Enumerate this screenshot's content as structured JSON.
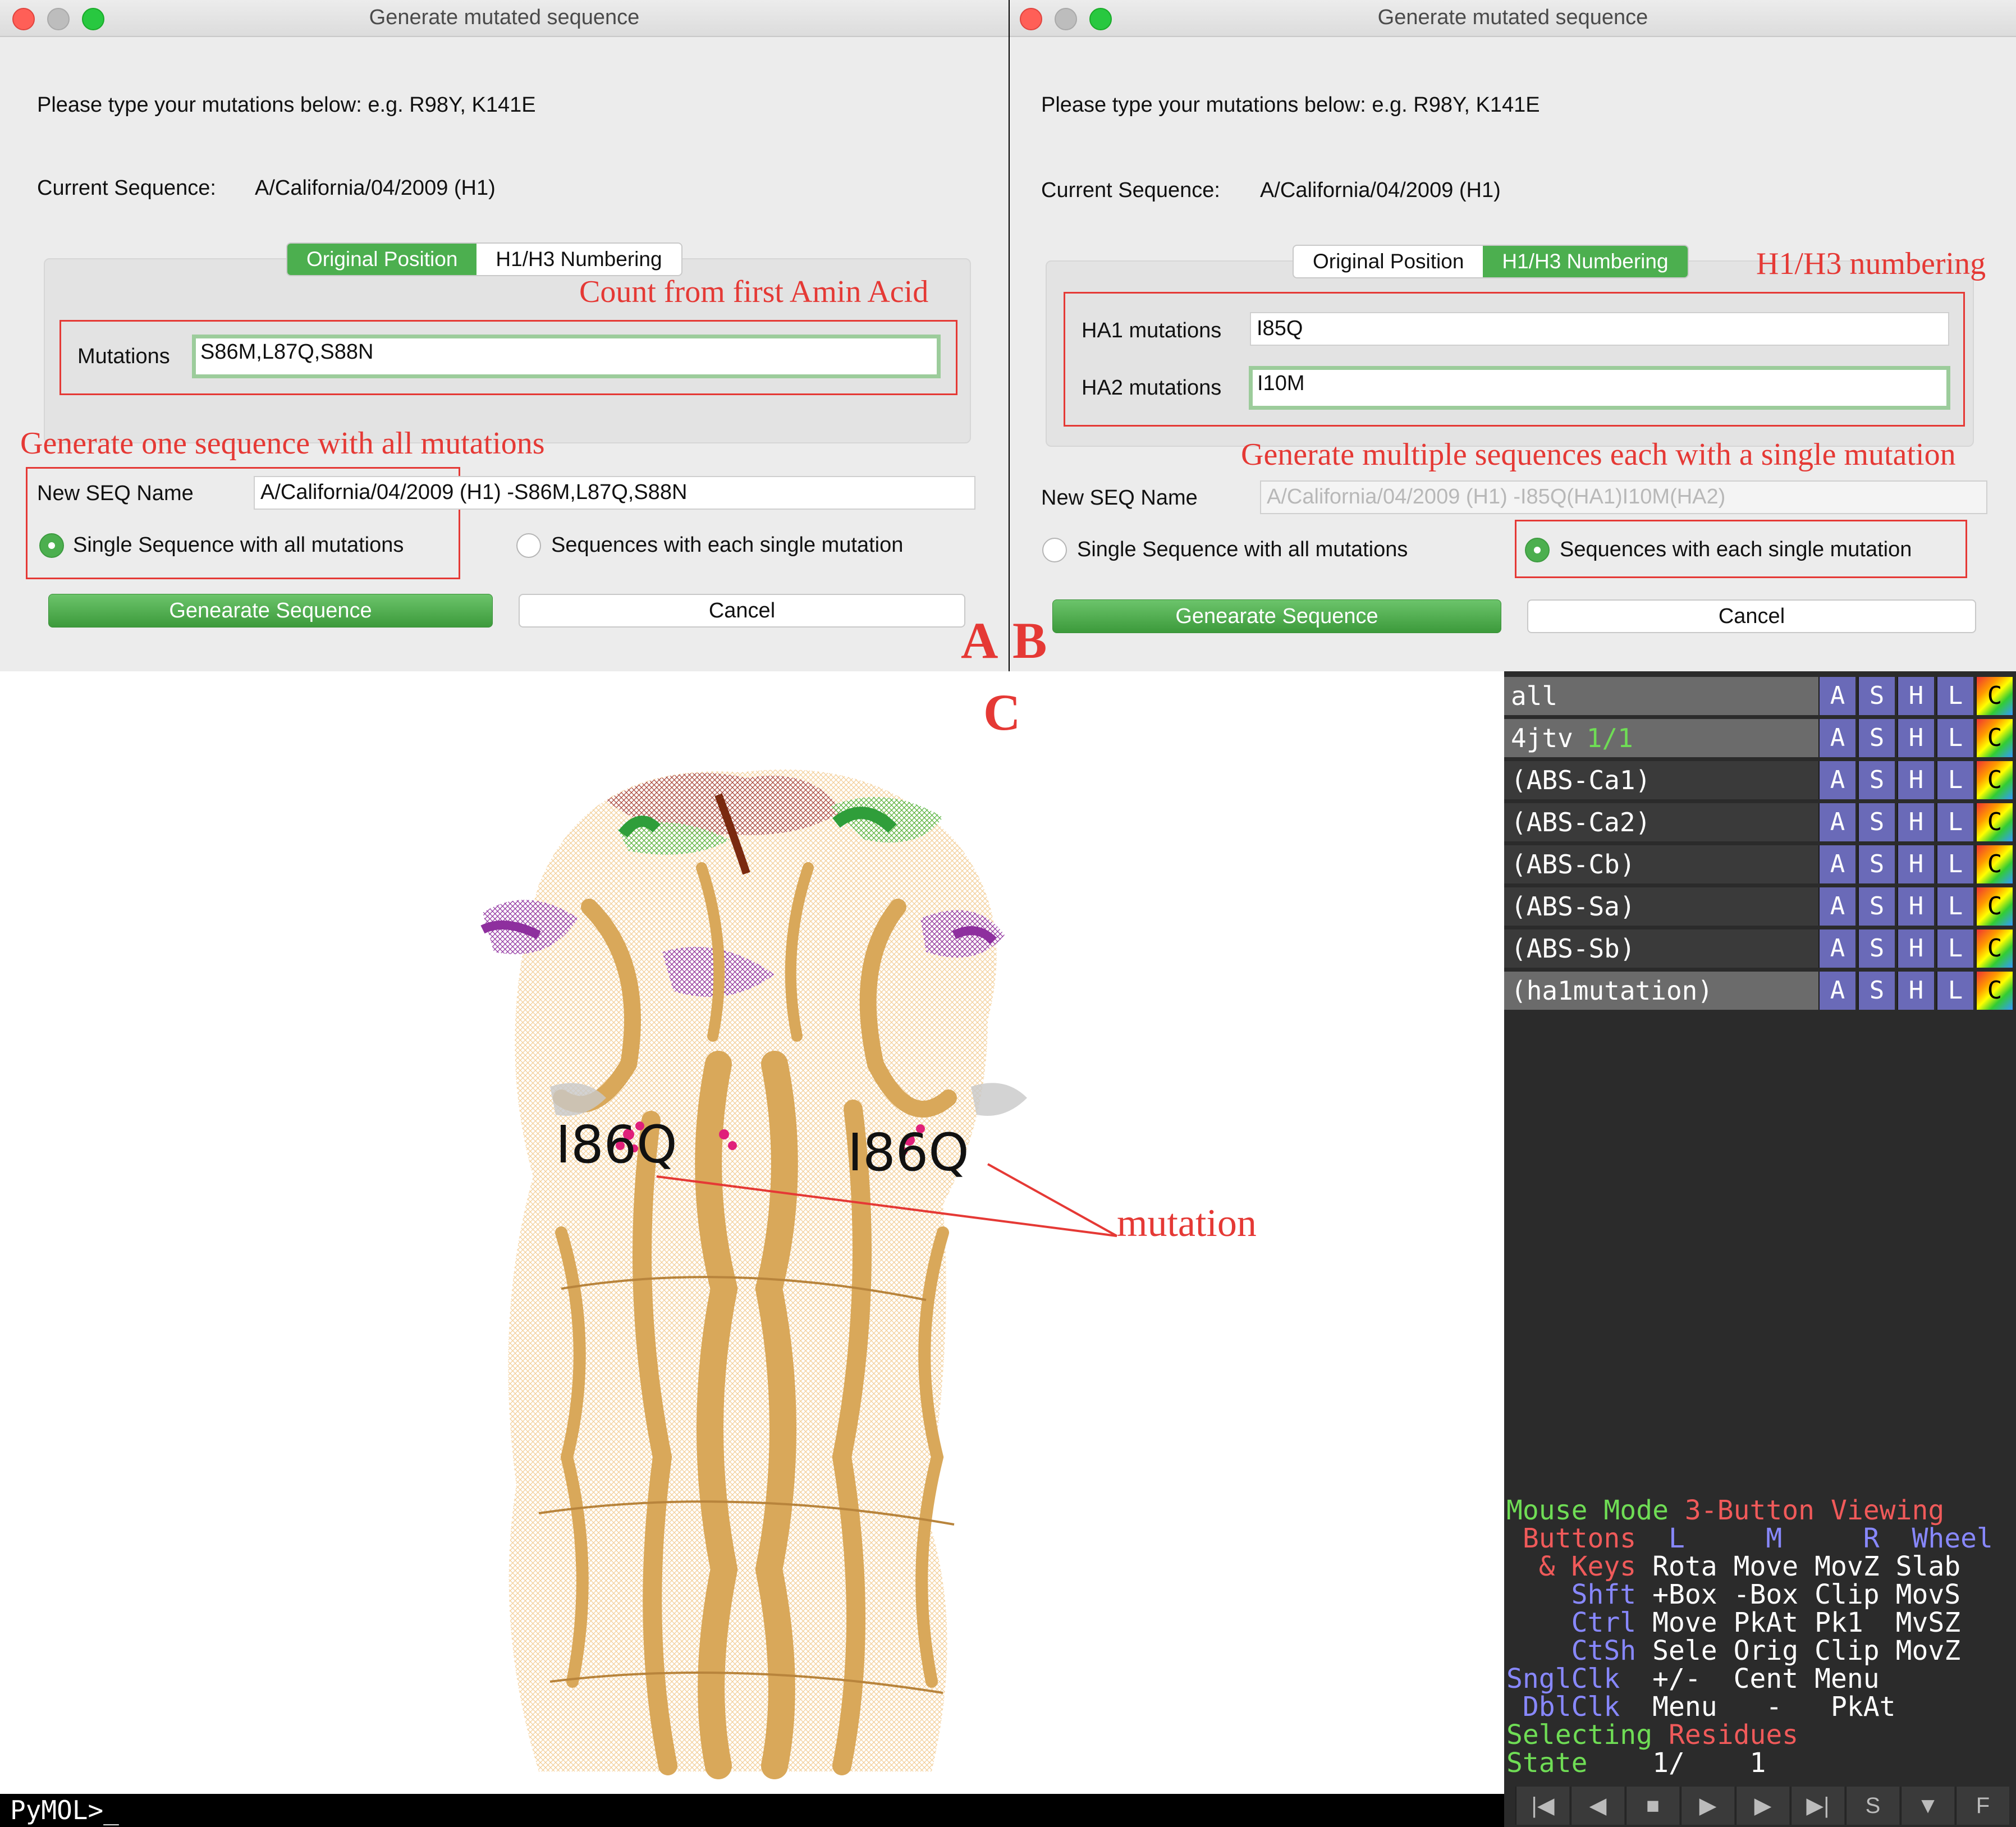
{
  "panel_labels": {
    "a": "A",
    "b": "B",
    "c": "C"
  },
  "dialog_a": {
    "title": "Generate mutated sequence",
    "instructions": "Please type your mutations below: e.g. R98Y, K141E",
    "current_seq_label": "Current Sequence:",
    "current_seq_value": "A/California/04/2009 (H1)",
    "tab_original": "Original Position",
    "tab_h1h3": "H1/H3 Numbering",
    "mutations_label": "Mutations",
    "mutations_value": "S86M,L87Q,S88N",
    "new_seq_label": "New SEQ Name",
    "new_seq_value": "A/California/04/2009 (H1) -S86M,L87Q,S88N",
    "radio_single": "Single Sequence with all mutations",
    "radio_each": "Sequences with each single mutation",
    "generate_button": "Genearate Sequence",
    "cancel_button": "Cancel",
    "annot_count": "Count from first Amin Acid",
    "annot_generate": "Generate one sequence with all mutations"
  },
  "dialog_b": {
    "title": "Generate mutated sequence",
    "instructions": "Please type your mutations below: e.g. R98Y, K141E",
    "current_seq_label": "Current Sequence:",
    "current_seq_value": "A/California/04/2009 (H1)",
    "tab_original": "Original Position",
    "tab_h1h3": "H1/H3 Numbering",
    "ha1_label": "HA1 mutations",
    "ha1_value": "I85Q",
    "ha2_label": "HA2 mutations",
    "ha2_value": "I10M",
    "new_seq_label": "New SEQ Name",
    "new_seq_value": "A/California/04/2009 (H1) -I85Q(HA1)I10M(HA2)",
    "radio_single": "Single Sequence with all mutations",
    "radio_each": "Sequences with each single mutation",
    "generate_button": "Genearate Sequence",
    "cancel_button": "Cancel",
    "annot_numbering": "H1/H3 numbering",
    "annot_generate": "Generate multiple sequences each with a single mutation"
  },
  "viewer": {
    "residue_label_left": "I86Q",
    "residue_label_right": "I86Q",
    "annot_mutation": "mutation"
  },
  "objects": [
    {
      "name": "all",
      "state": ""
    },
    {
      "name": "4jtv",
      "state": "1/1"
    },
    {
      "name": "(ABS-Ca1)",
      "state": ""
    },
    {
      "name": "(ABS-Ca2)",
      "state": ""
    },
    {
      "name": "(ABS-Cb)",
      "state": ""
    },
    {
      "name": "(ABS-Sa)",
      "state": ""
    },
    {
      "name": "(ABS-Sb)",
      "state": ""
    },
    {
      "name": "(ha1mutation)",
      "state": ""
    }
  ],
  "object_buttons": [
    "A",
    "S",
    "H",
    "L",
    "C"
  ],
  "mouse_mode": {
    "line1_a": "Mouse Mode ",
    "line1_b": "3-Button Viewing",
    "buttons_label": " Buttons",
    "buttons_cols": "  L     M     R  Wheel",
    "keys_label": "  & Keys",
    "keys_row": " Rota Move MovZ Slab",
    "shft_label": "    Shft",
    "shft_row": " +Box -Box Clip MovS",
    "ctrl_label": "    Ctrl",
    "ctrl_row": " Move PkAt Pk1  MvSZ",
    "ctsh_label": "    CtSh",
    "ctsh_row": " Sele Orig Clip MovZ",
    "sngl_label": "SnglClk",
    "sngl_row": "  +/-  Cent Menu",
    "dbl_label": " DblClk",
    "dbl_row": "  Menu   -   PkAt",
    "selecting_a": "Selecting ",
    "selecting_b": "Residues",
    "state_label": "State",
    "state_value": "    1/    1"
  },
  "command_prompt": "PyMOL>_",
  "player_buttons": [
    "|◀",
    "◀",
    "■",
    "▶",
    "▶",
    "▶|",
    "S",
    "▼",
    "F"
  ],
  "colors": {
    "accent_green": "#4caf4f",
    "annotation_red": "#e53935",
    "protein": "#d9a85a"
  }
}
